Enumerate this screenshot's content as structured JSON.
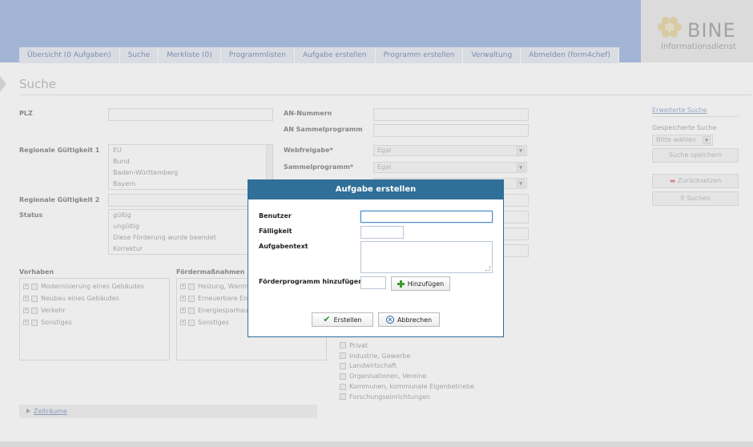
{
  "header": {
    "logo_title": "BINE",
    "logo_subtitle": "Informationsdienst"
  },
  "nav": {
    "items": [
      {
        "label": "Übersicht (0 Aufgaben)"
      },
      {
        "label": "Suche"
      },
      {
        "label": "Merkliste (0)"
      },
      {
        "label": "Programmlisten"
      },
      {
        "label": "Aufgabe erstellen"
      },
      {
        "label": "Programm erstellen"
      },
      {
        "label": "Verwaltung"
      },
      {
        "label": "Abmelden (form4chef)"
      }
    ]
  },
  "page": {
    "title": "Suche"
  },
  "form": {
    "plz_label": "PLZ",
    "an_nummern_label": "AN-Nummern",
    "an_sammel_label": "AN Sammelprogramm",
    "regional1_label": "Regionale Gültigkeit 1",
    "regional1_items": [
      "EU",
      "Bund",
      "Baden-Württemberg",
      "Bayern"
    ],
    "webfreigabe_label": "Webfreigabe*",
    "webfreigabe_value": "Egal",
    "sammelprogramm_label": "Sammelprogramm*",
    "sammelprogramm_value": "Egal",
    "regional2_label": "Regionale Gültigkeit 2",
    "status_label": "Status",
    "status_items": [
      "gültig",
      "ungültig",
      "Diese Förderung wurde beendet",
      "Korrektur"
    ],
    "vorhaben_label": "Vorhaben",
    "vorhaben_items": [
      "Modernisierung eines Gebäudes",
      "Neubau eines Gebäudes",
      "Verkehr",
      "Sonstiges"
    ],
    "foerder_label": "Fördermaßnahmen",
    "foerder_items": [
      "Heizung, Warmwa",
      "Erneuerbare Energ",
      "Energiesparhaus",
      "Sonstiges"
    ],
    "target_items": [
      "Privat",
      "Industrie, Gewerbe",
      "Landwirtschaft",
      "Organisationen, Vereine",
      "Kommunen, kommunale Eigenbetriebe",
      "Forschungseinrichtungen"
    ],
    "zeitraeume_label": "Zeiträume"
  },
  "sidebar": {
    "erweiterte_suche": "Erweiterte Suche",
    "gespeicherte_label": "Gespeicherte Suche",
    "gespeicherte_placeholder": "Bitte wählen",
    "suche_speichern": "Suche speichern",
    "zuruecksetzen": "Zurücksetzen",
    "suchen": "Suchen"
  },
  "dialog": {
    "title": "Aufgabe erstellen",
    "benutzer_label": "Benutzer",
    "faelligkeit_label": "Fälligkeit",
    "aufgabentext_label": "Aufgabentext",
    "foerderprogramm_label": "Förderprogramm hinzufügen",
    "hinzufuegen_button": "Hinzufügen",
    "erstellen_button": "Erstellen",
    "abbrechen_button": "Abbrechen"
  },
  "colors": {
    "header_band": "#a9bfe4",
    "dialog_title_bg": "#2f6f98",
    "nav_text": "#7d8fb3"
  }
}
